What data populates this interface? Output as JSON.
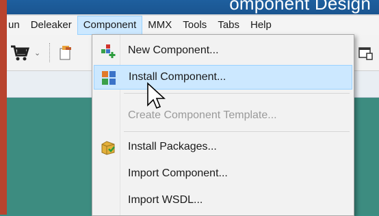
{
  "window": {
    "title_partial": "omponent Design"
  },
  "menubar": {
    "items": [
      {
        "label": "un",
        "active": false
      },
      {
        "label": "Deleaker",
        "active": false
      },
      {
        "label": "Component",
        "active": true
      },
      {
        "label": "MMX",
        "active": false
      },
      {
        "label": "Tools",
        "active": false
      },
      {
        "label": "Tabs",
        "active": false
      },
      {
        "label": "Help",
        "active": false
      }
    ]
  },
  "toolbar": {
    "icons": [
      "cart-icon",
      "dropdown-arrow-icon",
      "new-file-icon",
      "window-icon"
    ]
  },
  "component_menu": {
    "items": [
      {
        "label": "New Component...",
        "icon": "new-component-icon",
        "state": "normal"
      },
      {
        "label": "Install Component...",
        "icon": "install-component-icon",
        "state": "hover"
      },
      {
        "label": "Create Component Template...",
        "icon": "",
        "state": "disabled"
      },
      {
        "label": "Install Packages...",
        "icon": "install-packages-icon",
        "state": "normal"
      },
      {
        "label": "Import Component...",
        "icon": "",
        "state": "normal"
      },
      {
        "label": "Import WSDL...",
        "icon": "",
        "state": "normal"
      }
    ]
  },
  "colors": {
    "accent_hover": "#cce8ff",
    "title_bar": "#1e5f9e",
    "background_green": "#3a8f85",
    "left_edge": "#b8432e"
  }
}
